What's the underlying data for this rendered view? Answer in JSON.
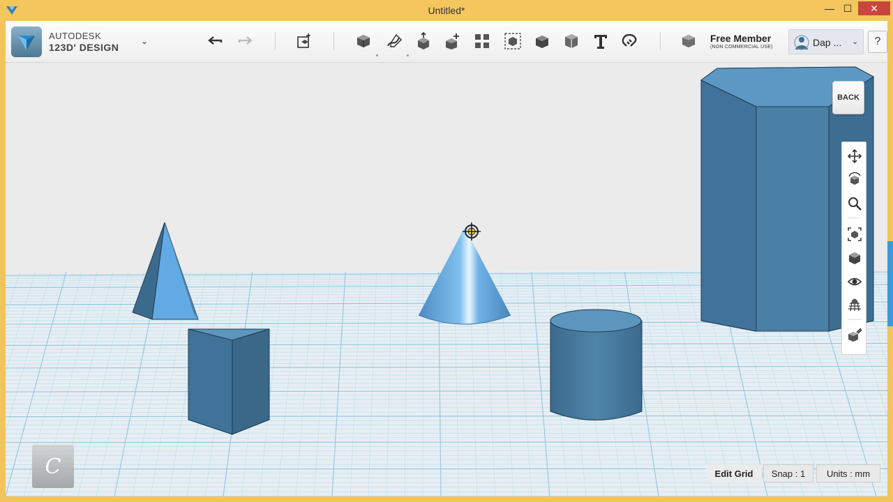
{
  "window": {
    "title": "Untitled*",
    "minimize_glyph": "—",
    "maximize_glyph": "☐",
    "close_glyph": "✕"
  },
  "toolbar": {
    "brand_line1": "AUTODESK",
    "brand_line2": "123D' DESIGN",
    "brand_caret": "⌄",
    "tools": [
      "undo-icon",
      "redo-icon",
      "new-object-icon",
      "primitives-icon",
      "sketch-icon",
      "construct-icon",
      "modify-icon",
      "pattern-icon",
      "grouping-icon",
      "combine-icon",
      "measure-icon",
      "text-icon",
      "snap-icon",
      "materials-icon"
    ]
  },
  "account": {
    "member": "Free Member",
    "member_sub": "(NON COMMERCIAL USE)",
    "profile_name": "Dap ...",
    "profile_caret": "⌄",
    "help": "?"
  },
  "viewcube": {
    "label": "BACK"
  },
  "navbar": {
    "items": [
      "pan-icon",
      "orbit-icon",
      "zoom-icon",
      "fit-icon",
      "view-cube-icon",
      "visibility-icon",
      "grid-icon",
      "material-view-icon"
    ]
  },
  "status": {
    "edit_grid": "Edit Grid",
    "snap": "Snap : 1",
    "units": "Units : mm"
  },
  "colors": {
    "frame": "#f2c45a",
    "viewport_bg": "#ebebeb",
    "grid_line": "#9fd2e6",
    "shape_light": "#6aaee3",
    "shape_dark": "#3f6e8f",
    "shape_mid": "#4d82a8"
  }
}
